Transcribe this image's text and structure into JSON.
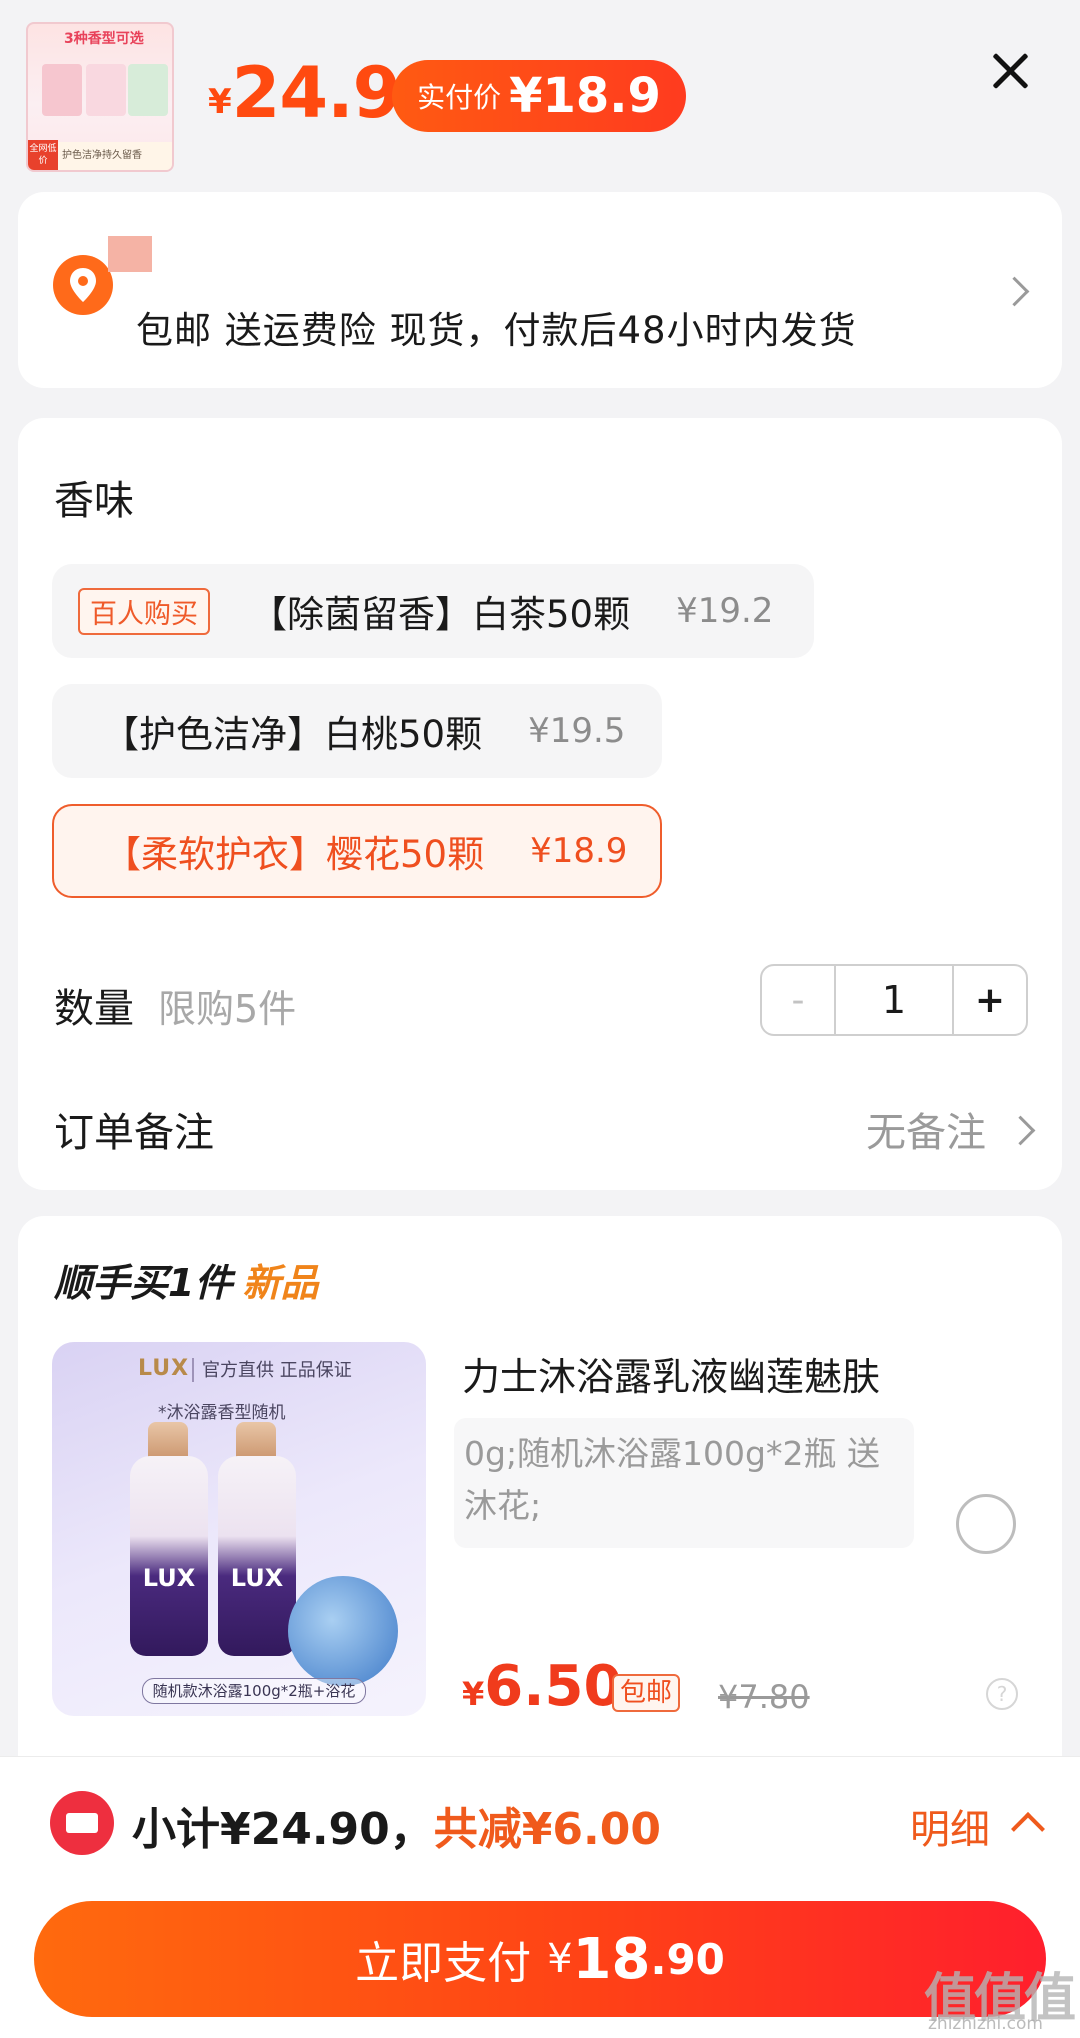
{
  "header": {
    "thumb_banner": "3种香型可选",
    "thumb_foot": "护色洁净持久留香",
    "thumb_tag": "全网低价",
    "price_currency": "¥",
    "price_value": "24.9",
    "pay_label": "实付价",
    "pay_value": "¥18.9"
  },
  "address": {
    "info": "包邮 送运费险 现货，付款后48小时内发货"
  },
  "options": {
    "section_title": "香味",
    "items": [
      {
        "badge": "百人购买",
        "name": "【除菌留香】白茶50颗",
        "price": "¥19.2",
        "selected": false
      },
      {
        "badge": "",
        "name": "【护色洁净】白桃50颗",
        "price": "¥19.5",
        "selected": false
      },
      {
        "badge": "",
        "name": "【柔软护衣】樱花50颗",
        "price": "¥18.9",
        "selected": true
      }
    ],
    "quantity_label": "数量",
    "quantity_limit": "限购5件",
    "quantity_minus": "-",
    "quantity_value": "1",
    "quantity_plus": "+",
    "note_label": "订单备注",
    "note_value": "无备注"
  },
  "addon": {
    "title": "顺手买1件",
    "title_new": "新品",
    "image": {
      "brand": "LUX",
      "headline": "官方直供 正品保证",
      "sub": "*沐浴露香型随机",
      "bottle_text": "LUX",
      "caption": "随机款沐浴露100g*2瓶+浴花"
    },
    "product_name": "力士沐浴露乳液幽莲魅肤",
    "product_spec": "0g;随机沐浴露100g*2瓶 送沐花;",
    "price_currency": "¥",
    "price_value": "6.50",
    "ship_tag": "包邮",
    "original_price": "¥7.80",
    "help": "?"
  },
  "bottom": {
    "subtotal_text": "小计¥24.90，",
    "discount_text": "共减¥6.00",
    "detail_label": "明细",
    "pay_label": "立即支付",
    "pay_currency": "¥",
    "pay_int": "18",
    "pay_dec": ".90"
  },
  "watermark": {
    "mark": "值值值",
    "domain": "zhizhizhi.com"
  },
  "colors": {
    "accent": "#ff4a10",
    "selected_border": "#ef5d2c",
    "discount": "#f05a1c",
    "coupon_icon": "#ee2f3f"
  },
  "icons": {
    "close": "close-icon",
    "location": "location-pin-icon",
    "chevron": "chevron-right-icon",
    "coupon": "coupon-ticket-icon",
    "expand": "chevron-up-icon"
  }
}
